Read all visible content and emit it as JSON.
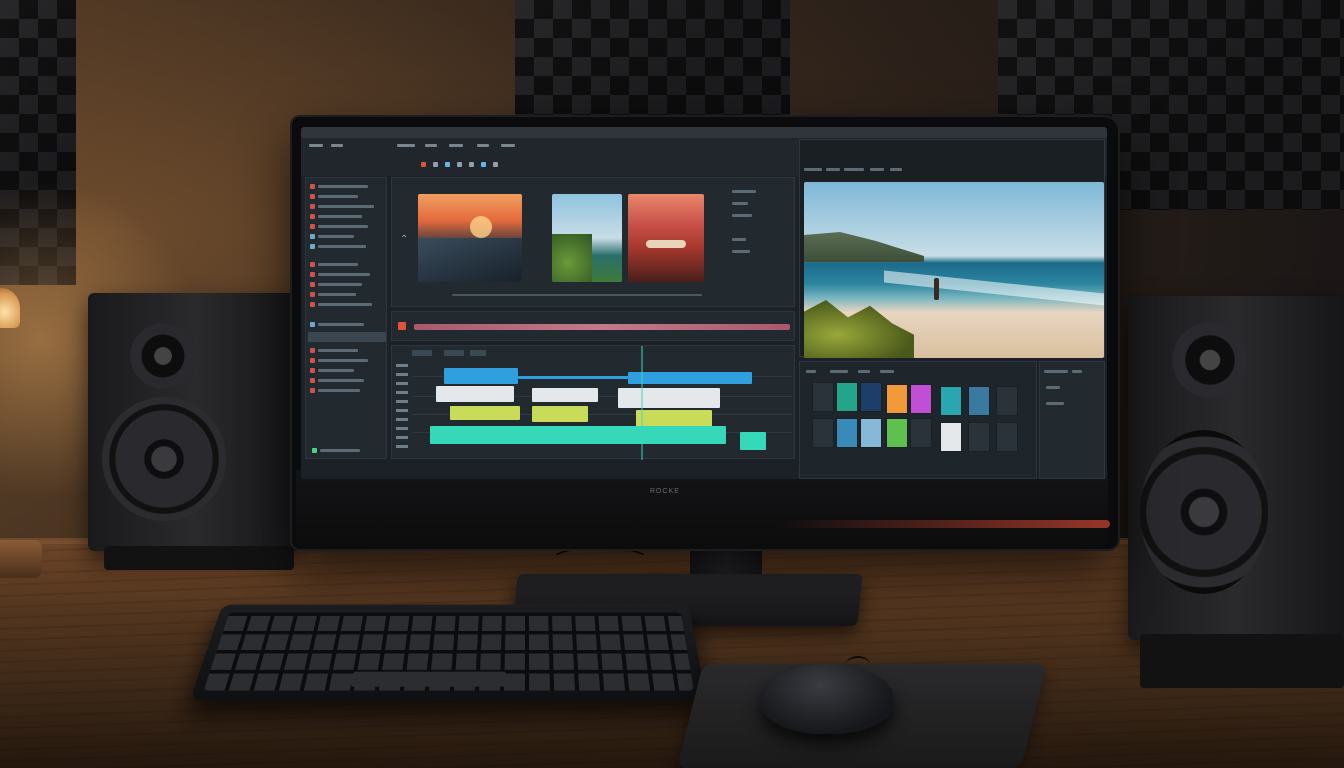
{
  "scene": {
    "description_colors": {
      "wall_warm": "#6b4a2c",
      "desk_wood": "#54361f",
      "screen_bg": "#1b2126",
      "accent_blue": "#2f9fe0",
      "accent_teal": "#35d8b8",
      "accent_lime": "#c9dc5a",
      "accent_white": "#e4e8ea",
      "accent_orange": "#f29a3a",
      "accent_magenta": "#c04fd6"
    },
    "objects": {
      "monitor_brand": "ROCKE",
      "icons": [
        "speaker-left-icon",
        "speaker-right-icon",
        "keyboard-icon",
        "mouse-icon",
        "lamp-icon"
      ]
    }
  },
  "editor": {
    "timeline_levels": {
      "playhead_progress": 0.62
    }
  }
}
